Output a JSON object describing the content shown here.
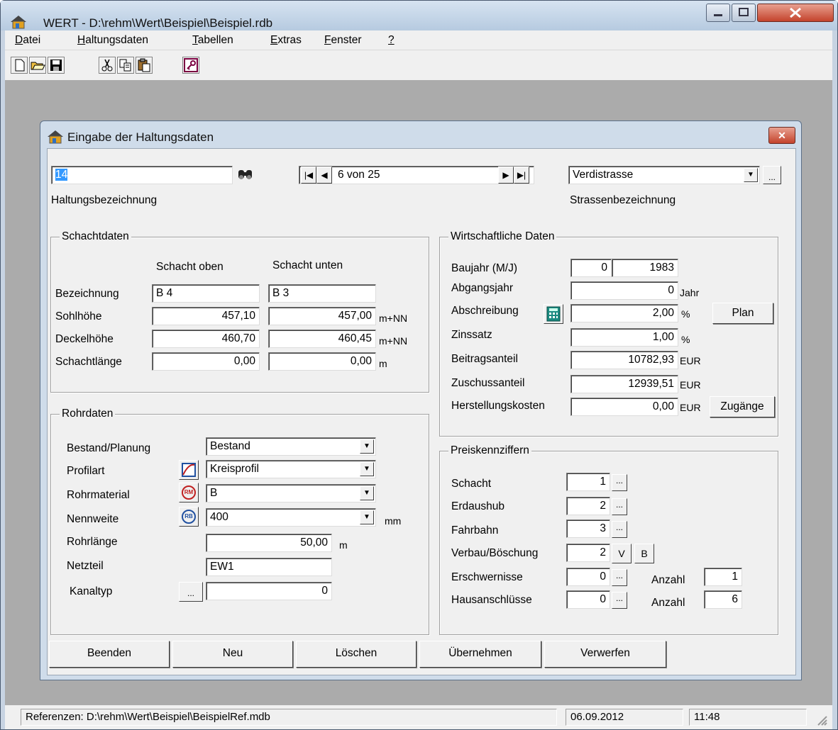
{
  "app": {
    "title": "WERT - D:\\rehm\\Wert\\Beispiel\\Beispiel.rdb"
  },
  "menu": {
    "items": [
      "Datei",
      "Haltungsdaten",
      "Tabellen",
      "Extras",
      "Fenster",
      "?"
    ]
  },
  "toolbar": {
    "icons": [
      "new-file-icon",
      "open-folder-icon",
      "save-icon",
      "cut-icon",
      "copy-icon",
      "paste-icon",
      "key-icon"
    ]
  },
  "dialog": {
    "title": "Eingabe der Haltungsdaten",
    "haltung_value": "14",
    "haltung_label": "Haltungsbezeichnung",
    "nav_record": "6 von 25",
    "strasse_value": "Verdistrasse",
    "strasse_label": "Strassenbezeichnung"
  },
  "schachtdaten": {
    "title": "Schachtdaten",
    "col_oben": "Schacht oben",
    "col_unten": "Schacht unten",
    "rows": [
      {
        "label": "Bezeichnung",
        "oben": "B 4",
        "unten": "B 3",
        "unit": ""
      },
      {
        "label": "Sohlhöhe",
        "oben": "457,10",
        "unten": "457,00",
        "unit": "m+NN"
      },
      {
        "label": "Deckelhöhe",
        "oben": "460,70",
        "unten": "460,45",
        "unit": "m+NN"
      },
      {
        "label": "Schachtlänge",
        "oben": "0,00",
        "unten": "0,00",
        "unit": "m"
      }
    ]
  },
  "rohrdaten": {
    "title": "Rohrdaten",
    "bestand_label": "Bestand/Planung",
    "bestand_value": "Bestand",
    "profil_label": "Profilart",
    "profil_value": "Kreisprofil",
    "material_label": "Rohrmaterial",
    "material_value": "B",
    "nennweite_label": "Nennweite",
    "nennweite_value": "400",
    "nennweite_unit": "mm",
    "laenge_label": "Rohrlänge",
    "laenge_value": "50,00",
    "laenge_unit": "m",
    "netzteil_label": "Netzteil",
    "netzteil_value": "EW1",
    "kanaltyp_label": "Kanaltyp",
    "kanaltyp_value": "0",
    "rm_badge": "RM",
    "rb_badge": "RB"
  },
  "wirtschaft": {
    "title": "Wirtschaftliche Daten",
    "baujahr_label": "Baujahr (M/J)",
    "baujahr_m": "0",
    "baujahr_j": "1983",
    "abgang_label": "Abgangsjahr",
    "abgang_value": "0",
    "abgang_unit": "Jahr",
    "abschreibung_label": "Abschreibung",
    "abschreibung_value": "2,00",
    "abschreibung_unit": "%",
    "plan_button": "Plan",
    "zins_label": "Zinssatz",
    "zins_value": "1,00",
    "zins_unit": "%",
    "beitrag_label": "Beitragsanteil",
    "beitrag_value": "10782,93",
    "beitrag_unit": "EUR",
    "zuschuss_label": "Zuschussanteil",
    "zuschuss_value": "12939,51",
    "zuschuss_unit": "EUR",
    "herstell_label": "Herstellungskosten",
    "herstell_value": "0,00",
    "herstell_unit": "EUR",
    "zugaenge_button": "Zugänge"
  },
  "preis": {
    "title": "Preiskennziffern",
    "schacht_label": "Schacht",
    "schacht_value": "1",
    "erdaushub_label": "Erdaushub",
    "erdaushub_value": "2",
    "fahrbahn_label": "Fahrbahn",
    "fahrbahn_value": "3",
    "verbau_label": "Verbau/Böschung",
    "verbau_value": "2",
    "v_button": "V",
    "b_button": "B",
    "erschw_label": "Erschwernisse",
    "erschw_value": "0",
    "haus_label": "Hausanschlüsse",
    "haus_value": "0",
    "anzahl_label": "Anzahl",
    "erschw_anzahl": "1",
    "haus_anzahl": "6",
    "ellipsis": "..."
  },
  "buttons": {
    "beenden": "Beenden",
    "neu": "Neu",
    "loeschen": "Löschen",
    "uebernehmen": "Übernehmen",
    "verwerfen": "Verwerfen"
  },
  "status": {
    "references": "Referenzen: D:\\rehm\\Wert\\Beispiel\\BeispielRef.mdb",
    "date": "06.09.2012",
    "time": "11:48"
  }
}
